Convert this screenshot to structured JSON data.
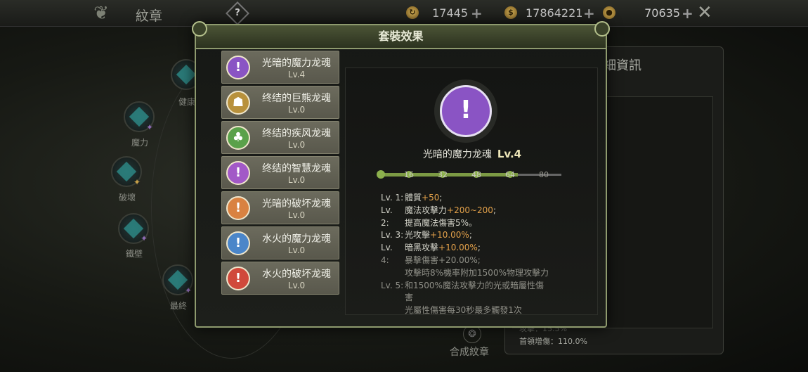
{
  "topbar": {
    "title": "紋章",
    "help": "?",
    "currencies": [
      {
        "icon": "refresh-coin-icon",
        "glyph": "↻",
        "value": "17445"
      },
      {
        "icon": "gold-pouch-icon",
        "glyph": "$",
        "value": "17864221"
      },
      {
        "icon": "coin-icon",
        "glyph": "●",
        "value": "70635"
      }
    ],
    "close_glyph": "✕"
  },
  "background": {
    "nodes": [
      {
        "label": "健康"
      },
      {
        "label": "魔力"
      },
      {
        "label": "破壞"
      },
      {
        "label": "鐵壁"
      },
      {
        "label": "最終"
      }
    ],
    "right_title": "細資訊",
    "foot_dim": "攻擊：15.5%",
    "foot": "首領增傷：110.0%",
    "compose_label": "合成紋章"
  },
  "modal": {
    "title": "套裝效果",
    "items": [
      {
        "name": "光暗的魔力龙魂",
        "level": "Lv.4",
        "color": "#8a54c4",
        "glyph": "!",
        "icon": "sword-icon"
      },
      {
        "name": "终结的巨熊龙魂",
        "level": "Lv.0",
        "color": "#b8913c",
        "glyph": "☗",
        "icon": "bear-icon"
      },
      {
        "name": "终结的疾风龙魂",
        "level": "Lv.0",
        "color": "#5aa14a",
        "glyph": "♣",
        "icon": "clover-icon"
      },
      {
        "name": "终结的智慧龙魂",
        "level": "Lv.0",
        "color": "#a259c7",
        "glyph": "!",
        "icon": "wisdom-sword-icon"
      },
      {
        "name": "光暗的破坏龙魂",
        "level": "Lv.0",
        "color": "#d98241",
        "glyph": "!",
        "icon": "destroy-sword-icon"
      },
      {
        "name": "水火的魔力龙魂",
        "level": "Lv.0",
        "color": "#4b86c9",
        "glyph": "!",
        "icon": "water-sword-icon"
      },
      {
        "name": "水火的破坏龙魂",
        "level": "Lv.0",
        "color": "#d0493b",
        "glyph": "!",
        "icon": "fire-sword-icon"
      }
    ],
    "detail": {
      "name": "光暗的魔力龙魂",
      "level": "Lv.4",
      "glyph": "!",
      "progress": {
        "value": 64,
        "max": 80,
        "ticks": [
          "16",
          "32",
          "48",
          "64",
          "80"
        ]
      },
      "lines": [
        {
          "k": "Lv. 1:",
          "parts": [
            "體質",
            "+50",
            ";"
          ]
        },
        {
          "k": "Lv.",
          "parts": [
            "魔法攻擊力",
            "+200~200",
            ";"
          ]
        },
        {
          "k": "2:",
          "parts": [
            "提高魔法傷害5%。",
            "",
            ""
          ]
        },
        {
          "k": "Lv. 3:",
          "parts": [
            "光攻擊",
            "+10.00%",
            ";"
          ]
        },
        {
          "k": "Lv.",
          "parts": [
            "暗黑攻擊",
            "+10.00%",
            ";"
          ]
        },
        {
          "k": "4:",
          "parts": [
            "暴擊傷害+20.00%;",
            "",
            ""
          ],
          "dim": true
        },
        {
          "k": "",
          "parts": [
            "攻擊時8%機率附加1500%物理攻擊力",
            "",
            ""
          ],
          "dim": true
        },
        {
          "k": "Lv. 5:",
          "parts": [
            "和1500%魔法攻擊力的光或暗屬性傷",
            "",
            ""
          ],
          "dim": true
        },
        {
          "k": "",
          "parts": [
            "害",
            "",
            ""
          ],
          "dim": true
        },
        {
          "k": "",
          "parts": [
            "光屬性傷害每30秒最多觸發1次",
            "",
            ""
          ],
          "dim": true
        }
      ]
    }
  }
}
